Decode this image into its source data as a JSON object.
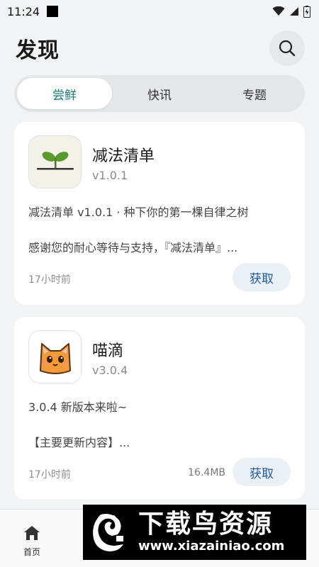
{
  "status_bar": {
    "time": "11:24"
  },
  "header": {
    "title": "发现"
  },
  "tabs": [
    {
      "label": "尝鲜",
      "active": true
    },
    {
      "label": "快讯",
      "active": false
    },
    {
      "label": "专题",
      "active": false
    }
  ],
  "cards": [
    {
      "name": "减法清单",
      "version": "v1.0.1",
      "description": "减法清单 v1.0.1 · 种下你的第一棵自律之树",
      "note": "感谢您的耐心等待与支持，『减法清单』...",
      "time": "17小时前",
      "size": "",
      "action": "获取",
      "icon": "sprout-icon"
    },
    {
      "name": "喵滴",
      "version": "v3.0.4",
      "description": "3.0.4 新版本来啦~",
      "note": "【主要更新内容】...",
      "time": "17小时前",
      "size": "16.4MB",
      "action": "获取",
      "icon": "cat-icon"
    }
  ],
  "bottom_nav": [
    {
      "label": "首页",
      "icon": "home-icon",
      "active": false
    }
  ],
  "watermark": {
    "title": "下载鸟资源",
    "url": "www.xiazainiao.com"
  },
  "colors": {
    "accent": "#1b7a77",
    "button_text": "#1d5a9c",
    "button_bg": "#eaf0f6"
  }
}
